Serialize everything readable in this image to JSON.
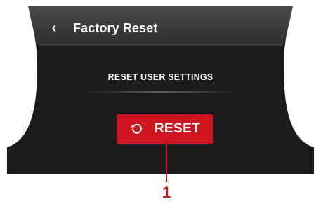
{
  "header": {
    "back_icon": "chevron-left-icon",
    "title": "Factory Reset"
  },
  "section": {
    "label": "RESET USER SETTINGS"
  },
  "reset_button": {
    "icon": "rotate-ccw-icon",
    "label": "RESET"
  },
  "callout": {
    "number": "1"
  },
  "colors": {
    "panel": "#1c1a1a",
    "header": "#3b3b3b",
    "accent_red": "#d0151f"
  }
}
